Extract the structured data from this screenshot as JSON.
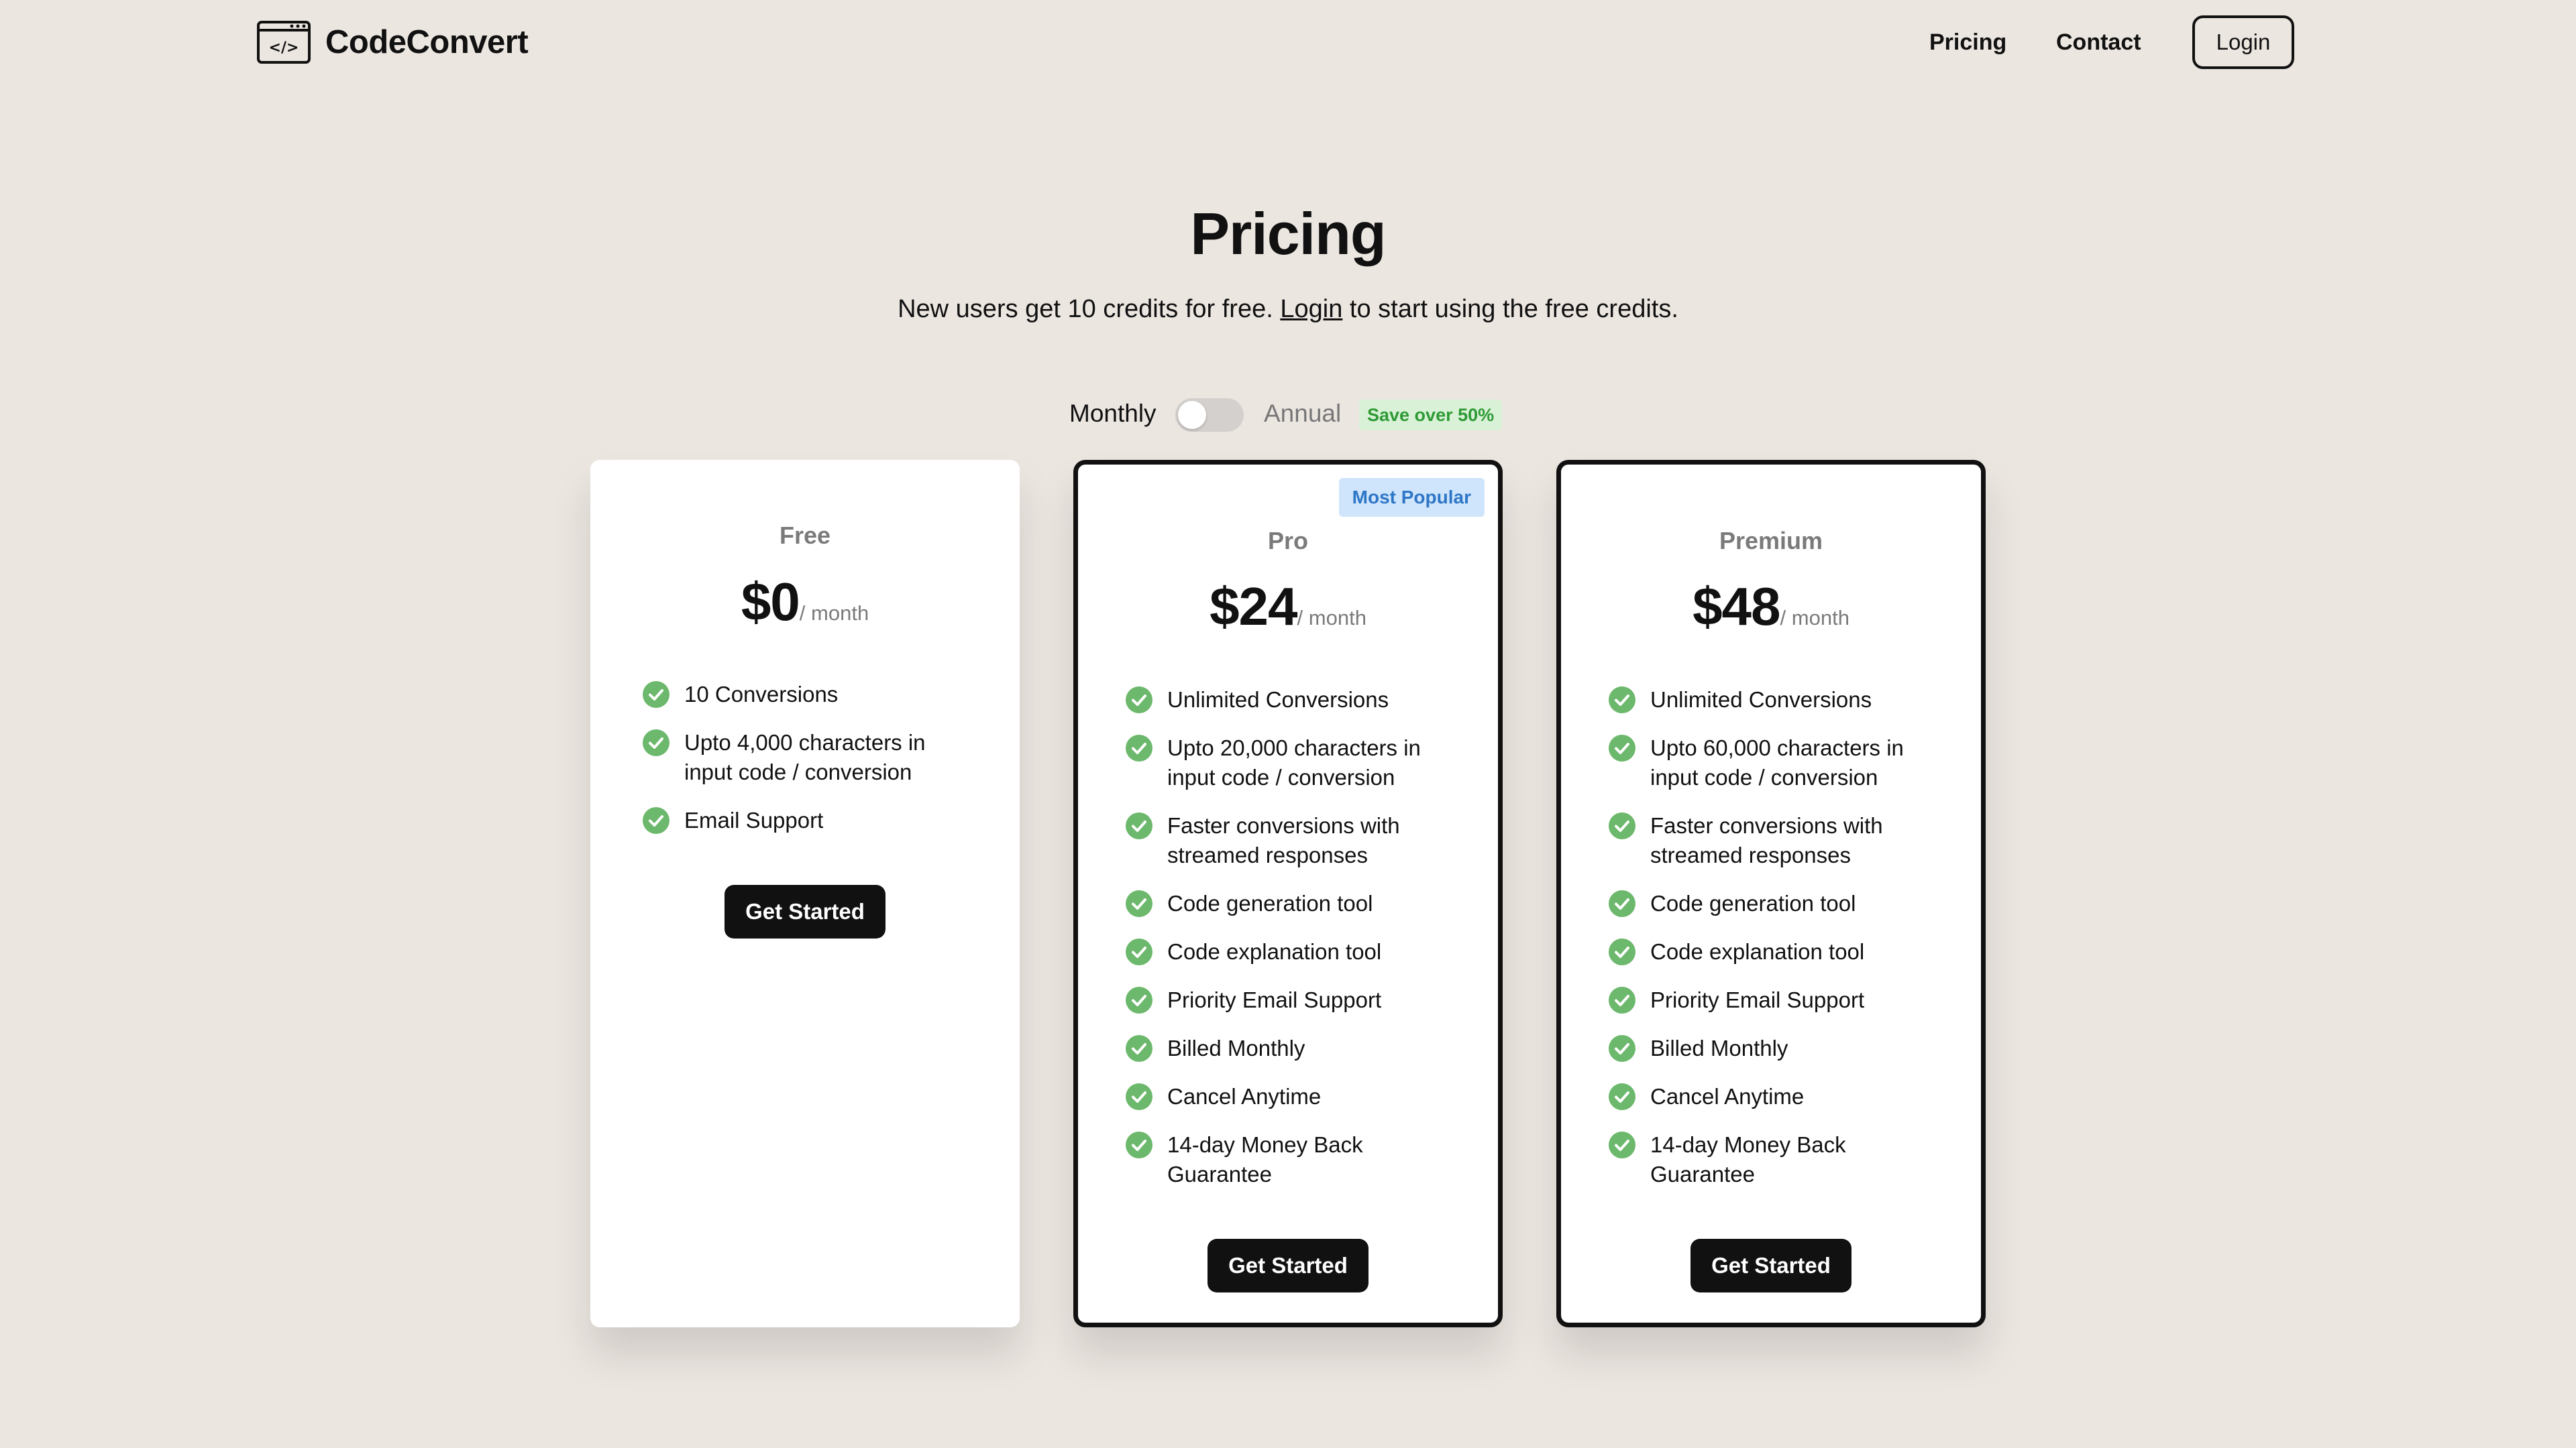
{
  "brand": {
    "name": "CodeConvert",
    "logo_icon": "code-window-icon"
  },
  "nav": {
    "pricing": "Pricing",
    "contact": "Contact",
    "login": "Login"
  },
  "hero": {
    "title": "Pricing",
    "subtitle_before": "New users get 10 credits for free.",
    "subtitle_link": "Login",
    "subtitle_after": "to start using the free credits."
  },
  "billing": {
    "monthly_label": "Monthly",
    "annual_label": "Annual",
    "save_badge": "Save over 50%",
    "annual_selected": false
  },
  "colors": {
    "check": "#6cb86c",
    "accent_badge_bg": "#cfe5fb",
    "save_badge_text": "#2e9a35"
  },
  "plans": [
    {
      "name": "Free",
      "price": "$0",
      "period": "/ month",
      "features": [
        "10 Conversions",
        "Upto 4,000 characters in input code / conversion",
        "Email Support"
      ],
      "cta": "Get Started"
    },
    {
      "name": "Pro",
      "badge": "Most Popular",
      "price": "$24",
      "period": "/ month",
      "features": [
        "Unlimited Conversions",
        "Upto 20,000 characters in input code / conversion",
        "Faster conversions with streamed responses",
        "Code generation tool",
        "Code explanation tool",
        "Priority Email Support",
        "Billed Monthly",
        "Cancel Anytime",
        "14-day Money Back Guarantee"
      ],
      "cta": "Get Started"
    },
    {
      "name": "Premium",
      "price": "$48",
      "period": "/ month",
      "features": [
        "Unlimited Conversions",
        "Upto 60,000 characters in input code / conversion",
        "Faster conversions with streamed responses",
        "Code generation tool",
        "Code explanation tool",
        "Priority Email Support",
        "Billed Monthly",
        "Cancel Anytime",
        "14-day Money Back Guarantee"
      ],
      "cta": "Get Started"
    }
  ]
}
